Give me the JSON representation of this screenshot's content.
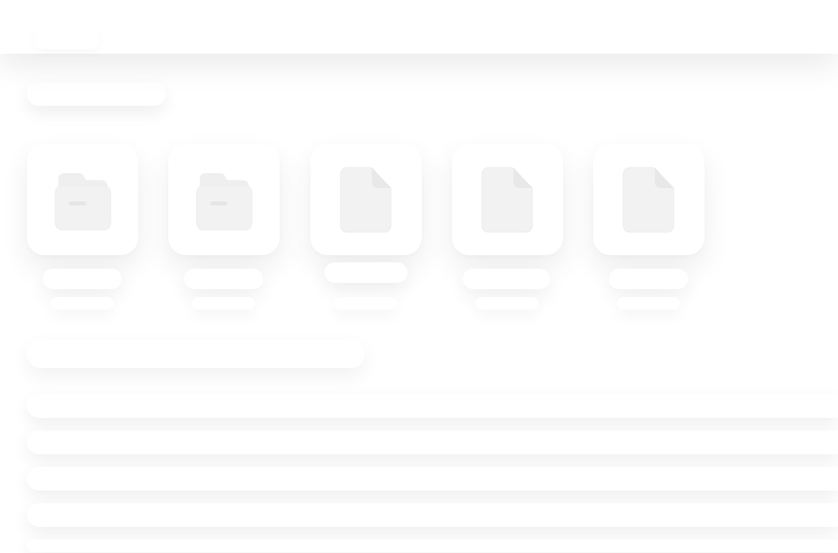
{
  "icons": {
    "folder": "folder-icon",
    "file": "file-icon"
  },
  "colors": {
    "background": "#ffffff",
    "icon_fill": "#f3f3f3",
    "icon_fold": "#e9e9e9"
  },
  "tiles": [
    {
      "icon": "folder-icon"
    },
    {
      "icon": "folder-icon"
    },
    {
      "icon": "file-icon"
    },
    {
      "icon": "file-icon"
    },
    {
      "icon": "file-icon"
    }
  ]
}
